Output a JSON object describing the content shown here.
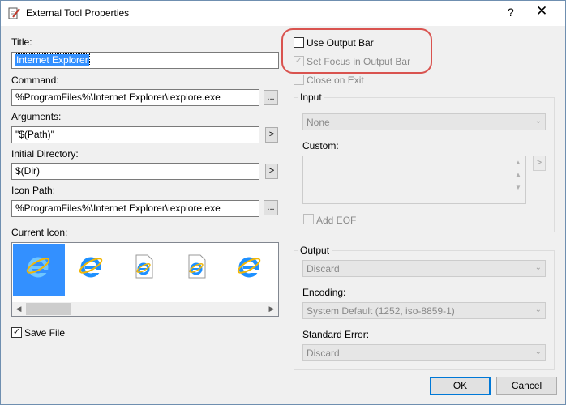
{
  "window": {
    "title": "External Tool Properties",
    "help": "?",
    "close": "✕"
  },
  "form": {
    "title_label": "Title:",
    "title_value": "Internet Explorer",
    "command_label": "Command:",
    "command_value": "%ProgramFiles%\\Internet Explorer\\iexplore.exe",
    "arguments_label": "Arguments:",
    "arguments_value": "\"$(Path)\"",
    "initial_dir_label": "Initial Directory:",
    "initial_dir_value": "$(Dir)",
    "icon_path_label": "Icon Path:",
    "icon_path_value": "%ProgramFiles%\\Internet Explorer\\iexplore.exe",
    "current_icon_label": "Current Icon:",
    "browse_label": "...",
    "insert_label": ">",
    "save_file_label": "Save File",
    "save_file_checked": true
  },
  "options": {
    "use_output_bar": "Use Output Bar",
    "use_output_bar_checked": false,
    "set_focus": "Set Focus in Output Bar",
    "set_focus_checked": true,
    "close_on_exit": "Close on Exit",
    "close_on_exit_checked": false
  },
  "input": {
    "group_title": "Input",
    "selected": "None",
    "custom_label": "Custom:",
    "add_eof": "Add EOF"
  },
  "output": {
    "group_title": "Output",
    "selected": "Discard",
    "encoding_label": "Encoding:",
    "encoding_value": "System Default (1252, iso-8859-1)",
    "stderr_label": "Standard Error:",
    "stderr_value": "Discard"
  },
  "buttons": {
    "ok": "OK",
    "cancel": "Cancel"
  },
  "icons": [
    "ie-icon",
    "ie-icon",
    "ie-document-icon",
    "ie-document-icon",
    "ie-icon"
  ],
  "colors": {
    "selection": "#3390ff",
    "highlight_ring": "#d9534f",
    "ie_blue": "#1e90ff",
    "ie_gold": "#f2b705"
  }
}
